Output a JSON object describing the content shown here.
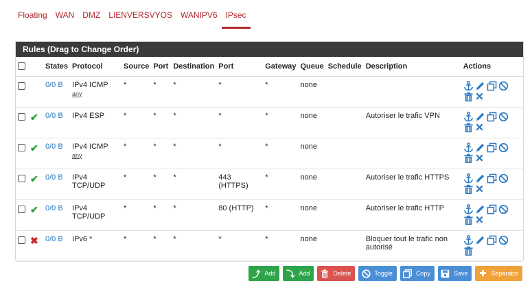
{
  "tabs": [
    "Floating",
    "WAN",
    "DMZ",
    "LIENVERSVYOS",
    "WANIPV6",
    "IPsec"
  ],
  "active_tab": "IPsec",
  "panel": {
    "title": "Rules (Drag to Change Order)"
  },
  "columns": [
    "",
    "",
    "States",
    "Protocol",
    "Source",
    "Port",
    "Destination",
    "Port",
    "Gateway",
    "Queue",
    "Schedule",
    "Description",
    "Actions"
  ],
  "rows": [
    {
      "status": "enabled",
      "states": "0/0 B",
      "protocol": "IPv4 ICMP",
      "protocol_sub": "any",
      "source": "*",
      "sport": "*",
      "dest": "*",
      "dport": "*",
      "gateway": "*",
      "queue": "none",
      "schedule": "",
      "description": "",
      "has_delete_x": true
    },
    {
      "status": "pass",
      "states": "0/0 B",
      "protocol": "IPv4 ESP",
      "protocol_sub": "",
      "source": "*",
      "sport": "*",
      "dest": "*",
      "dport": "*",
      "gateway": "*",
      "queue": "none",
      "schedule": "",
      "description": "Autoriser le trafic VPN",
      "has_delete_x": true
    },
    {
      "status": "pass",
      "states": "0/0 B",
      "protocol": "IPv4 ICMP",
      "protocol_sub": "any",
      "source": "*",
      "sport": "*",
      "dest": "*",
      "dport": "*",
      "gateway": "*",
      "queue": "none",
      "schedule": "",
      "description": "",
      "has_delete_x": true
    },
    {
      "status": "pass",
      "states": "0/0 B",
      "protocol": "IPv4 TCP/UDP",
      "protocol_sub": "",
      "source": "*",
      "sport": "*",
      "dest": "*",
      "dport": "443 (HTTPS)",
      "gateway": "*",
      "queue": "none",
      "schedule": "",
      "description": "Autoriser le trafic HTTPS",
      "has_delete_x": true
    },
    {
      "status": "pass",
      "states": "0/0 B",
      "protocol": "IPv4 TCP/UDP",
      "protocol_sub": "",
      "source": "*",
      "sport": "*",
      "dest": "*",
      "dport": "80 (HTTP)",
      "gateway": "*",
      "queue": "none",
      "schedule": "",
      "description": "Autoriser le trafic HTTP",
      "has_delete_x": true
    },
    {
      "status": "block",
      "states": "0/0 B",
      "protocol": "IPv6 *",
      "protocol_sub": "",
      "source": "*",
      "sport": "*",
      "dest": "*",
      "dport": "*",
      "gateway": "*",
      "queue": "none",
      "schedule": "",
      "description": "Bloquer tout le trafic non autorisé",
      "has_delete_x": false
    }
  ],
  "buttons": {
    "add_top": "Add",
    "add_bottom": "Add",
    "delete": "Delete",
    "toggle": "Toggle",
    "copy": "Copy",
    "save": "Save",
    "separator": "Separator"
  },
  "colors": {
    "accent": "#b3262c",
    "header": "#3b3b3b",
    "action_icon": "#2b7ac4",
    "pass": "#2e9c3c",
    "block": "#c82b2b"
  }
}
